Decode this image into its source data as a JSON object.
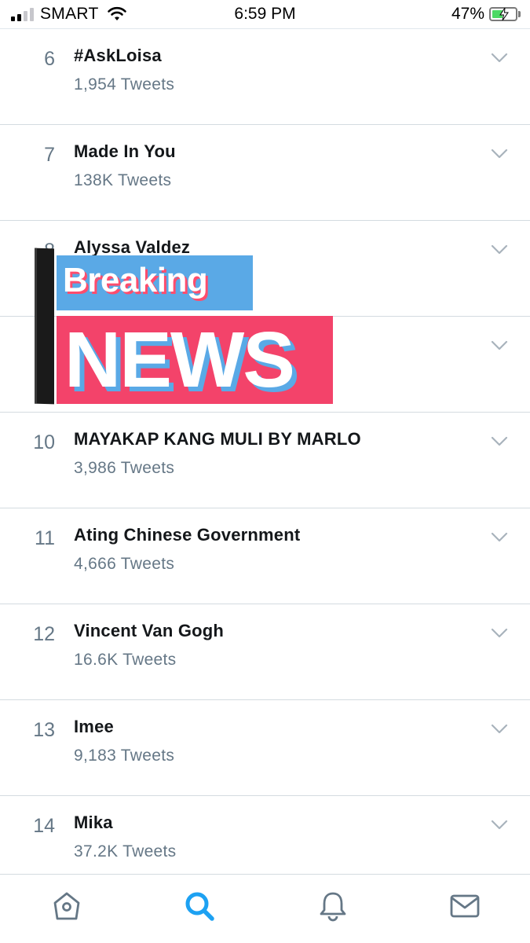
{
  "status_bar": {
    "carrier": "SMART",
    "time": "6:59 PM",
    "battery_percent": "47%",
    "battery_level": 0.47,
    "signal_bars": 2,
    "signal_bars_total": 4
  },
  "trends": [
    {
      "rank": "6",
      "name": "#AskLoisa",
      "count": "1,954 Tweets"
    },
    {
      "rank": "7",
      "name": "Made In You",
      "count": "138K Tweets"
    },
    {
      "rank": "8",
      "name": "Alyssa Valdez",
      "count": ""
    },
    {
      "rank": "",
      "name": "",
      "count": ""
    },
    {
      "rank": "10",
      "name": "MAYAKAP KANG MULI BY MARLO",
      "count": "3,986 Tweets"
    },
    {
      "rank": "11",
      "name": "Ating Chinese Government",
      "count": "4,666 Tweets"
    },
    {
      "rank": "12",
      "name": "Vincent Van Gogh",
      "count": "16.6K Tweets"
    },
    {
      "rank": "13",
      "name": "Imee",
      "count": "9,183 Tweets"
    },
    {
      "rank": "14",
      "name": "Mika",
      "count": "37.2K Tweets"
    }
  ],
  "sticker": {
    "line1": "Breaking",
    "line2": "NEWS"
  },
  "tab_bar": {
    "tabs": [
      {
        "icon": "home-icon",
        "active": false
      },
      {
        "icon": "search-icon",
        "active": true
      },
      {
        "icon": "bell-icon",
        "active": false
      },
      {
        "icon": "mail-icon",
        "active": false
      }
    ],
    "active_color": "#1da1f2",
    "inactive_color": "#657786"
  }
}
